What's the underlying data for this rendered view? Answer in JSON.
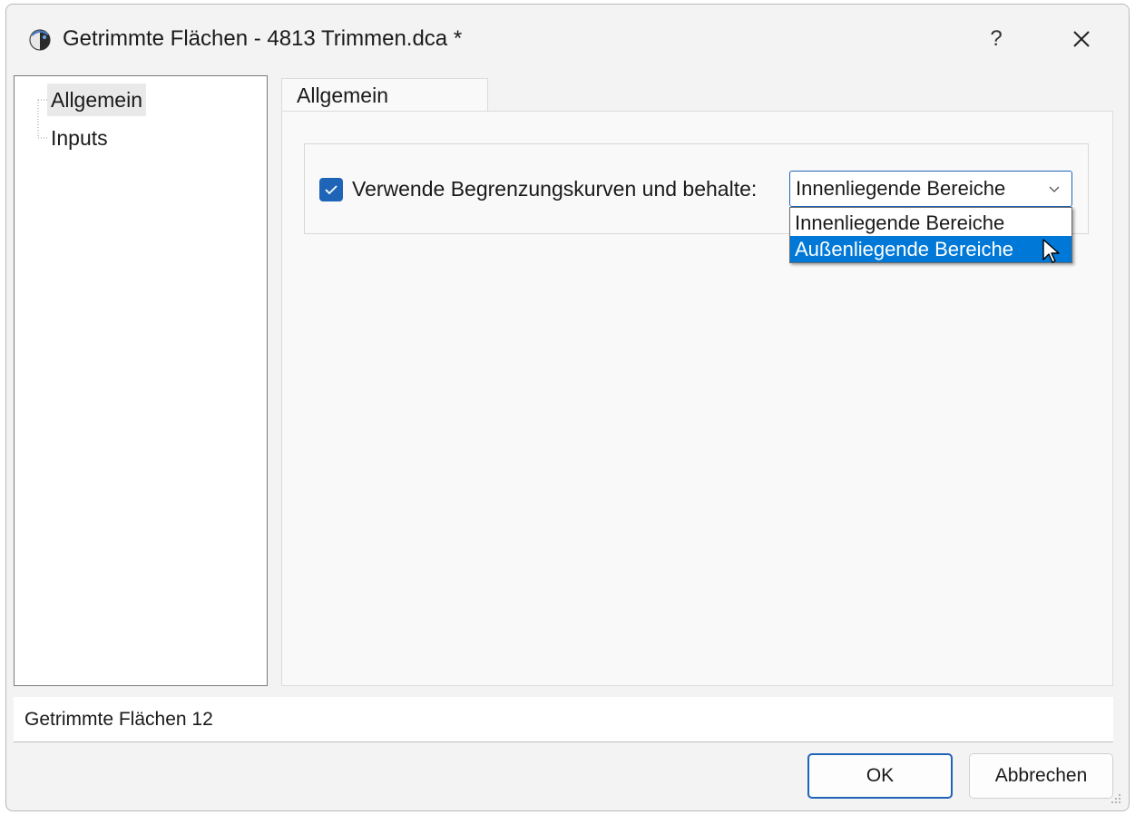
{
  "window": {
    "title": "Getrimmte Flächen - 4813 Trimmen.dca *",
    "help_label": "?",
    "close_icon": "close-icon",
    "app_icon": "app-logo-icon"
  },
  "tree": {
    "items": [
      {
        "label": "Allgemein",
        "selected": true
      },
      {
        "label": "Inputs",
        "selected": false
      }
    ]
  },
  "tabs": [
    {
      "label": "Allgemein",
      "active": true
    }
  ],
  "options": {
    "checkbox": {
      "label": "Verwende Begrenzungskurven und behalte:",
      "checked": true
    },
    "combo": {
      "selected": "Innenliegende Bereiche",
      "open": true,
      "items": [
        {
          "label": "Innenliegende Bereiche",
          "highlighted": false
        },
        {
          "label": "Außenliegende Bereiche",
          "highlighted": true
        }
      ]
    }
  },
  "status": {
    "text": "Getrimmte Flächen 12"
  },
  "buttons": {
    "ok_label": "OK",
    "cancel_label": "Abbrechen"
  },
  "colors": {
    "accent": "#1f65b7",
    "highlight": "#0078d7",
    "dialog_bg": "#f3f3f3"
  }
}
